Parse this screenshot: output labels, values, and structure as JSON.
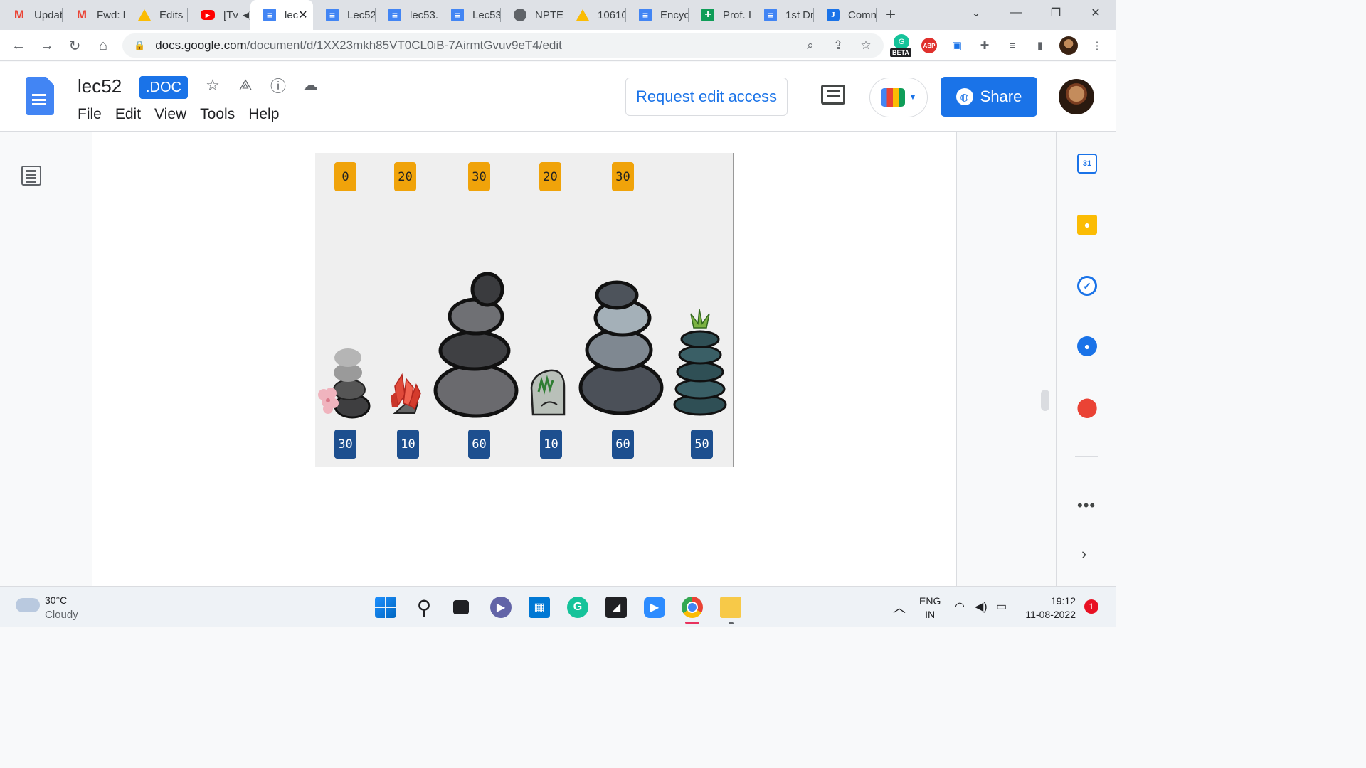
{
  "browser": {
    "tabs": [
      {
        "label": "Updat",
        "icon": "gmail-icon"
      },
      {
        "label": "Fwd: F",
        "icon": "gmail-icon"
      },
      {
        "label": "Edits",
        "icon": "drive-icon"
      },
      {
        "label": "[Tv",
        "icon": "youtube-icon"
      },
      {
        "label": "lec",
        "icon": "docs-icon"
      },
      {
        "label": "Lec52",
        "icon": "docs-icon"
      },
      {
        "label": "lec53.",
        "icon": "docs-icon"
      },
      {
        "label": "Lec53",
        "icon": "docs-icon"
      },
      {
        "label": "NPTEl",
        "icon": "globe-icon"
      },
      {
        "label": "10610",
        "icon": "drive-icon"
      },
      {
        "label": "Encyc",
        "icon": "docs-icon"
      },
      {
        "label": "Prof. I",
        "icon": "sheets-icon"
      },
      {
        "label": "1st Dr",
        "icon": "docs-icon"
      },
      {
        "label": "Comn",
        "icon": "j-icon"
      }
    ],
    "url_host": "docs.google.com",
    "url_path": "/document/d/1XX23mkh85VT0CL0iB-7AirmtGvuv9eT4/edit",
    "beta_badge": "BETA",
    "abp_label": "ABP"
  },
  "docs": {
    "title": "lec52",
    "badge": ".DOC",
    "menu": [
      "File",
      "Edit",
      "View",
      "Tools",
      "Help"
    ],
    "request_access": "Request edit access",
    "share": "Share"
  },
  "figure": {
    "top_labels": [
      "0",
      "20",
      "30",
      "20",
      "30"
    ],
    "bottom_labels": [
      "30",
      "10",
      "60",
      "10",
      "60",
      "50"
    ]
  },
  "side_panel": {
    "calendar_day": "31"
  },
  "taskbar": {
    "temp": "30°C",
    "weather": "Cloudy",
    "lang_line1": "ENG",
    "lang_line2": "IN",
    "time": "19:12",
    "date": "11-08-2022",
    "notifications": "1"
  },
  "colors": {
    "accent": "#1a73e8",
    "top_tag": "#f0a30a",
    "bottom_tag": "#1d4f8f"
  }
}
